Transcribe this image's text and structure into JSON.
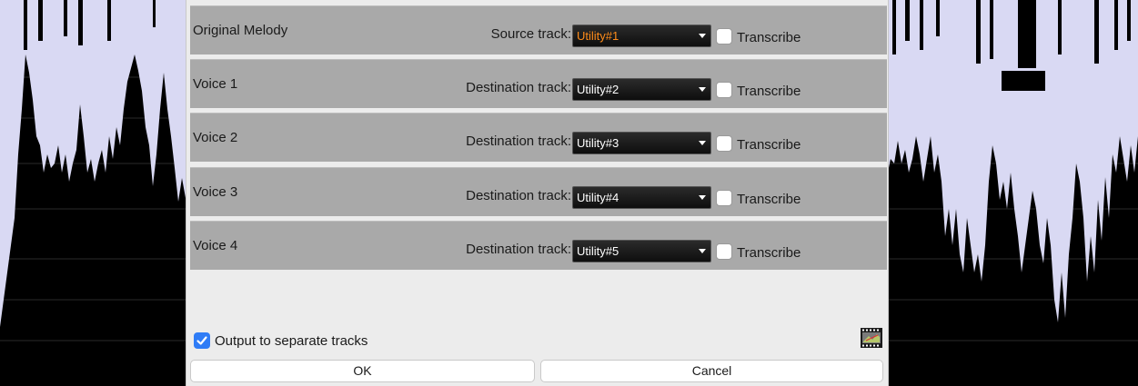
{
  "dialog": {
    "rows": [
      {
        "name": "Original Melody",
        "track_label": "Source track:",
        "track_value": "Utility#1",
        "transcribe_label": "Transcribe",
        "transcribe_checked": false
      },
      {
        "name": "Voice 1",
        "track_label": "Destination track:",
        "track_value": "Utility#2",
        "transcribe_label": "Transcribe",
        "transcribe_checked": false
      },
      {
        "name": "Voice 2",
        "track_label": "Destination track:",
        "track_value": "Utility#3",
        "transcribe_label": "Transcribe",
        "transcribe_checked": false
      },
      {
        "name": "Voice 3",
        "track_label": "Destination track:",
        "track_value": "Utility#4",
        "transcribe_label": "Transcribe",
        "transcribe_checked": false
      },
      {
        "name": "Voice 4",
        "track_label": "Destination track:",
        "track_value": "Utility#5",
        "transcribe_label": "Transcribe",
        "transcribe_checked": false
      }
    ],
    "output_separate_label": "Output to separate tracks",
    "output_separate_checked": true,
    "ok_label": "OK",
    "cancel_label": "Cancel"
  },
  "colors": {
    "accent_track_value": "#ff8c1a",
    "checkbox_checked": "#2f7cf6",
    "waveform": "#d9d9f3",
    "row_background": "#a9a9a9"
  },
  "icons": {
    "film_button": "film-strip-icon",
    "select_chevron": "chevron-down-icon",
    "checkmark": "checkmark-icon"
  }
}
